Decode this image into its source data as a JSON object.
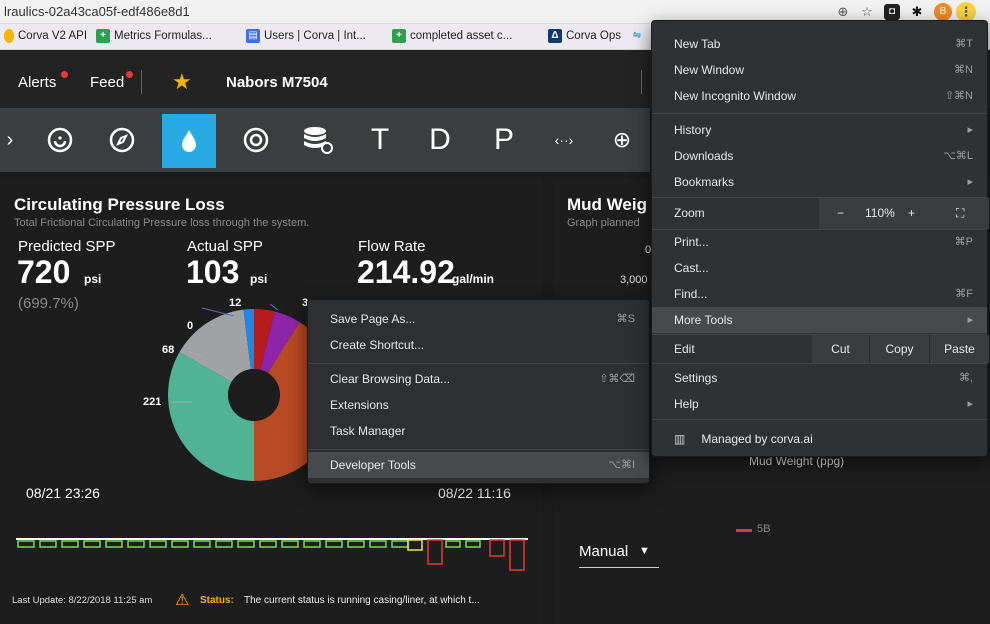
{
  "browser": {
    "url": "lraulics-02a43ca05f-edf486e8d1",
    "avatar": "B",
    "bookmarks": [
      "Corva V2 API",
      "Metrics Formulas...",
      "Users | Corva | Int...",
      "completed asset c...",
      "Corva Ops"
    ]
  },
  "header": {
    "alerts": "Alerts",
    "feed": "Feed",
    "rig": "Nabors M7504"
  },
  "toolbar": {
    "letters": [
      "T",
      "D",
      "P"
    ],
    "arrows": "‹··›",
    "plus": "⊕"
  },
  "panel": {
    "title": "Circulating Pressure Loss",
    "subtitle": "Total Frictional Circulating Pressure loss through the system.",
    "predicted_label": "Predicted SPP",
    "predicted_value": "720",
    "predicted_unit": "psi",
    "predicted_pct": "(699.7%)",
    "actual_label": "Actual SPP",
    "actual_value": "103",
    "actual_unit": "psi",
    "flow_label": "Flow Rate",
    "flow_value": "214.92",
    "flow_unit": "gal/min",
    "start_time": "08/21 23:26",
    "end_time": "08/22 11:16",
    "footer_update": "Last Update: 8/22/2018 11:25 am",
    "footer_status_label": "Status:",
    "footer_status_text": "The current status is running casing/liner, at which t..."
  },
  "pie": {
    "labels": [
      "12",
      "3",
      "0",
      "68",
      "221"
    ],
    "colors": [
      "#4fb394",
      "#b84a25",
      "#a0a3a3",
      "#8e24aa",
      "#b71c1c",
      "#1e88e5"
    ]
  },
  "right_panel": {
    "title": "Mud Weig",
    "subtitle": "Graph planned",
    "tick_0": "0",
    "tick_3000": "3,000",
    "legend_axis": "Mud Weight (ppg)",
    "legend_series": "5B",
    "mode": "Manual"
  },
  "chrome_menu": {
    "items": [
      {
        "label": "New Tab",
        "shortcut": "⌘T"
      },
      {
        "label": "New Window",
        "shortcut": "⌘N"
      },
      {
        "label": "New Incognito Window",
        "shortcut": "⇧⌘N"
      },
      {
        "label": "History",
        "shortcut": "▸"
      },
      {
        "label": "Downloads",
        "shortcut": "⌥⌘L"
      },
      {
        "label": "Bookmarks",
        "shortcut": "▸"
      },
      {
        "label": "Zoom",
        "shortcut": ""
      },
      {
        "label": "Print...",
        "shortcut": "⌘P"
      },
      {
        "label": "Cast...",
        "shortcut": ""
      },
      {
        "label": "Find...",
        "shortcut": "⌘F"
      },
      {
        "label": "More Tools",
        "shortcut": "▸"
      },
      {
        "label": "Edit",
        "shortcut": ""
      },
      {
        "label": "Settings",
        "shortcut": "⌘,"
      },
      {
        "label": "Help",
        "shortcut": "▸"
      }
    ],
    "zoom": {
      "minus": "−",
      "value": "110%",
      "plus": "+"
    },
    "edit": {
      "cut": "Cut",
      "copy": "Copy",
      "paste": "Paste"
    },
    "managed": "Managed by corva.ai"
  },
  "more_tools_menu": {
    "items": [
      {
        "label": "Save Page As...",
        "shortcut": "⌘S"
      },
      {
        "label": "Create Shortcut...",
        "shortcut": ""
      },
      {
        "label": "Clear Browsing Data...",
        "shortcut": "⇧⌘⌫"
      },
      {
        "label": "Extensions",
        "shortcut": ""
      },
      {
        "label": "Task Manager",
        "shortcut": ""
      },
      {
        "label": "Developer Tools",
        "shortcut": "⌥⌘I"
      }
    ]
  }
}
